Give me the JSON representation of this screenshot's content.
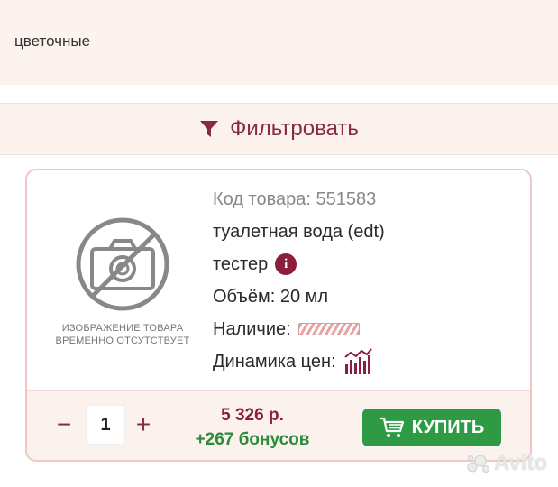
{
  "category": {
    "tag_text": "цветочные"
  },
  "filter": {
    "label": "Фильтровать",
    "icon": "funnel-icon"
  },
  "product": {
    "photo_caption_line1": "ИЗОБРАЖЕНИЕ ТОВАРА",
    "photo_caption_line2": "ВРЕМЕННО ОТСУТСТВУЕТ",
    "code_label": "Код товара: 551583",
    "type": "туалетная вода (edt)",
    "tester_label": "тестер",
    "info_icon_text": "i",
    "volume_label": "Объём: 20 мл",
    "availability_label": "Наличие:",
    "price_dynamics_label": "Динамика цен:"
  },
  "cart": {
    "minus_label": "−",
    "quantity": "1",
    "plus_label": "+",
    "price": "5 326 р.",
    "bonus": "+267 бонусов",
    "buy_label": "КУПИТЬ"
  },
  "watermark": {
    "text": "Avito"
  },
  "colors": {
    "accent": "#8a1e3c",
    "buy_button": "#2e9a44",
    "bonus": "#2b8b3a",
    "panel_bg": "#fbf1ed"
  }
}
